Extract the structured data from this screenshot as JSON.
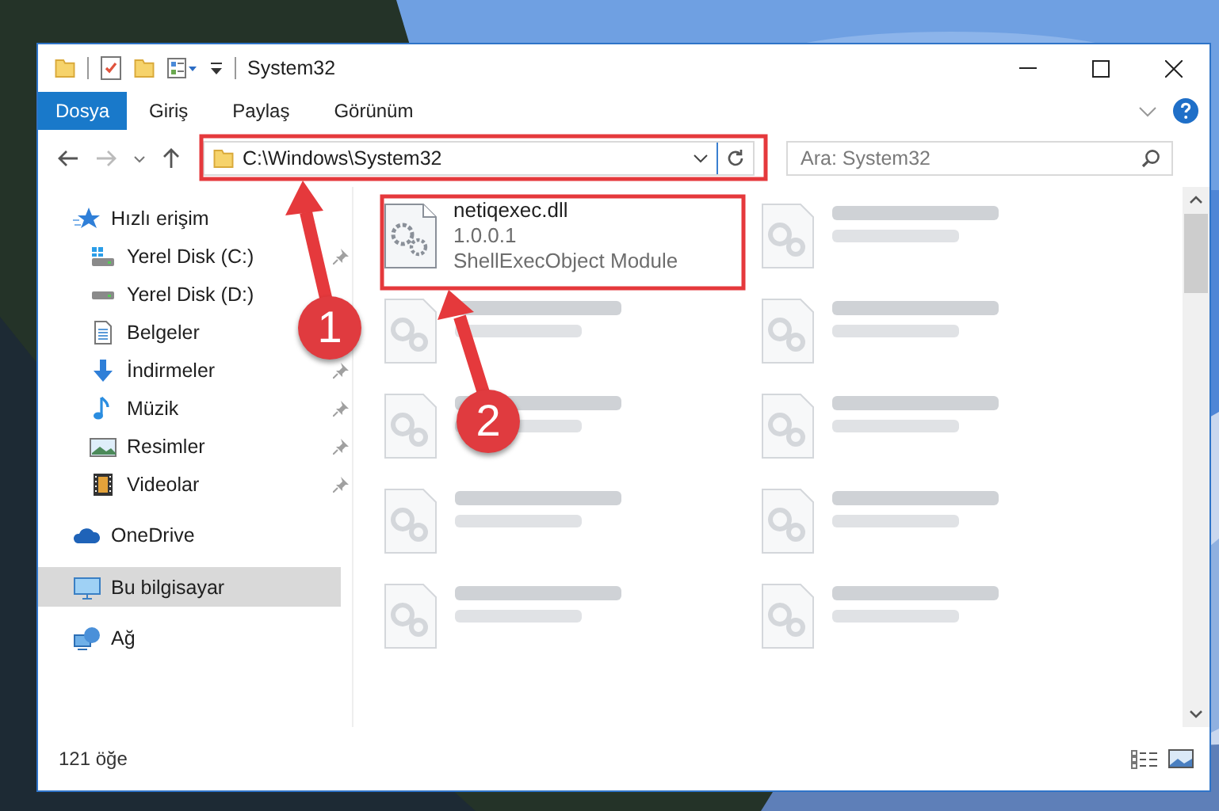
{
  "window": {
    "title": "System32"
  },
  "ribbon_tabs": [
    {
      "label": "Dosya",
      "kind": "file"
    },
    {
      "label": "Giriş",
      "kind": "tab"
    },
    {
      "label": "Paylaş",
      "kind": "tab"
    },
    {
      "label": "Görünüm",
      "kind": "tab"
    }
  ],
  "address_bar": {
    "value": "C:\\Windows\\System32"
  },
  "search": {
    "placeholder": "Ara: System32"
  },
  "sidebar": {
    "items": [
      {
        "label": "Hızlı erişim",
        "kind": "star",
        "selected": false,
        "children": [
          {
            "label": "Yerel Disk (C:)",
            "kind": "drive-c",
            "pinned": true
          },
          {
            "label": "Yerel Disk (D:)",
            "kind": "drive",
            "pinned": false
          },
          {
            "label": "Belgeler",
            "kind": "docs",
            "pinned": false
          },
          {
            "label": "İndirmeler",
            "kind": "download",
            "pinned": true
          },
          {
            "label": "Müzik",
            "kind": "music",
            "pinned": true
          },
          {
            "label": "Resimler",
            "kind": "pictures",
            "pinned": true
          },
          {
            "label": "Videolar",
            "kind": "video",
            "pinned": true
          }
        ]
      },
      {
        "label": "OneDrive",
        "kind": "cloud",
        "selected": false
      },
      {
        "label": "Bu bilgisayar",
        "kind": "pc",
        "selected": true
      },
      {
        "label": "Ağ",
        "kind": "network",
        "selected": false
      }
    ]
  },
  "files": [
    {
      "kind": "file",
      "name": "netiqexec.dll",
      "lines": [
        "1.0.0.1",
        "ShellExecObject Module"
      ]
    },
    {
      "kind": "blurred"
    },
    {
      "kind": "blurred"
    },
    {
      "kind": "blurred"
    },
    {
      "kind": "blurred"
    },
    {
      "kind": "blurred"
    },
    {
      "kind": "blurred"
    },
    {
      "kind": "blurred"
    },
    {
      "kind": "blurred"
    },
    {
      "kind": "blurred"
    }
  ],
  "status_bar": {
    "count": "121 öğe"
  },
  "annotations": [
    {
      "number": "1"
    },
    {
      "number": "2"
    }
  ]
}
